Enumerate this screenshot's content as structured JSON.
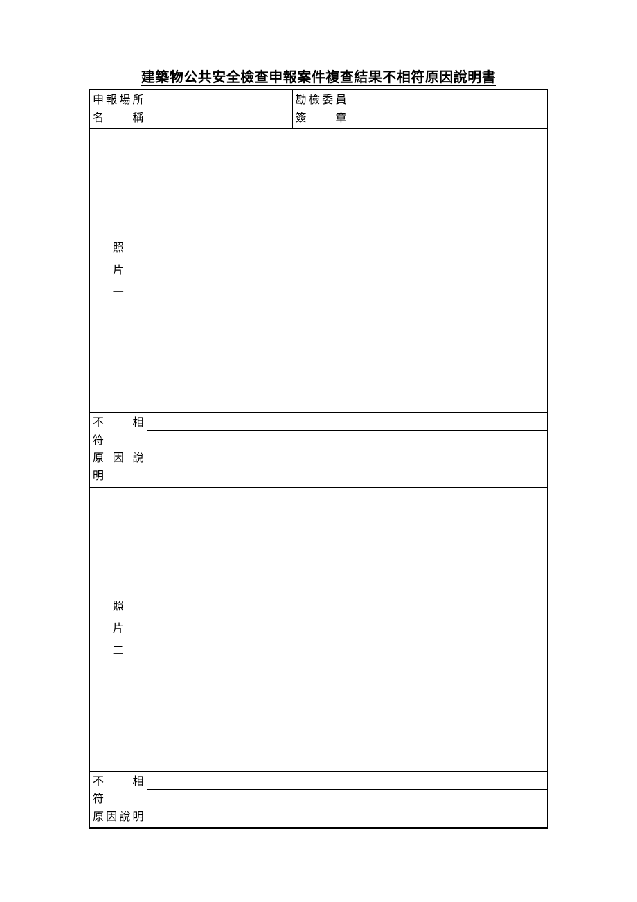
{
  "title": "建築物公共安全檢查申報案件複查結果不相符原因說明書",
  "header": {
    "venue_label_line1": "申報場所",
    "venue_label_line2": "名　　稱",
    "venue_value": "",
    "inspector_label_line1": "勘檢委員",
    "inspector_label_line2": "簽　　章",
    "inspector_value": ""
  },
  "section1": {
    "photo_label_char1": "照",
    "photo_label_char2": "片",
    "photo_label_char3": "一",
    "reason_label_line1": "不　相　符",
    "reason_label_line2": "原 因 說 明",
    "reason_value_line1": "",
    "reason_value_line2": ""
  },
  "section2": {
    "photo_label_char1": "照",
    "photo_label_char2": "片",
    "photo_label_char3": "二",
    "reason_label_line1": "不　相　符",
    "reason_label_line2": "原因說明",
    "reason_value_line1": "",
    "reason_value_line2": ""
  }
}
